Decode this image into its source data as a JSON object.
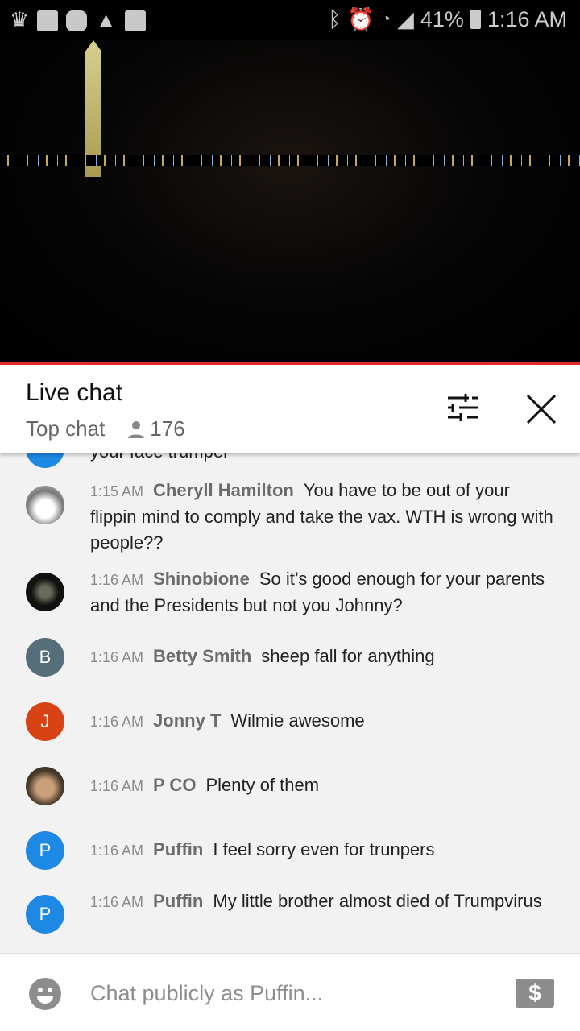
{
  "status_bar": {
    "battery": "41%",
    "time": "1:16 AM",
    "left_icons": [
      "crown-icon",
      "folder-icon",
      "m-app-icon",
      "warning-icon",
      "image-icon"
    ],
    "right_icons": [
      "bluetooth-icon",
      "alarm-icon",
      "wifi-icon",
      "signal-icon",
      "battery-icon"
    ]
  },
  "colors": {
    "progress": "#e52d27",
    "avatar_blue": "#1e88e5",
    "avatar_slate": "#546e7a",
    "avatar_red": "#d84315"
  },
  "header": {
    "title": "Live chat",
    "mode": "Top chat",
    "viewers": "176"
  },
  "chat": {
    "partial_text": "your face trumper",
    "messages": [
      {
        "time": "1:15 AM",
        "author": "Cheryll Hamilton",
        "text": "You have to be out of your flippin mind to comply and take the vax. WTH is wrong with people??",
        "avatar": "photo"
      },
      {
        "time": "1:16 AM",
        "author": "Shinobione",
        "text": "So it’s good enough for your parents and the Presidents but not you Johnny?",
        "avatar": "photo"
      },
      {
        "time": "1:16 AM",
        "author": "Betty Smith",
        "text": "sheep fall for anything",
        "avatar": "B"
      },
      {
        "time": "1:16 AM",
        "author": "Jonny T",
        "text": "Wilmie awesome",
        "avatar": "J"
      },
      {
        "time": "1:16 AM",
        "author": "P CO",
        "text": "Plenty of them",
        "avatar": "photo"
      },
      {
        "time": "1:16 AM",
        "author": "Puffin",
        "text": "I feel sorry even for trunpers",
        "avatar": "P"
      },
      {
        "time": "1:16 AM",
        "author": "Puffin",
        "text": "My little brother almost died of Trumpvirus",
        "avatar": "P"
      }
    ]
  },
  "input": {
    "placeholder": "Chat publicly as Puffin...",
    "dollar_symbol": "$"
  }
}
